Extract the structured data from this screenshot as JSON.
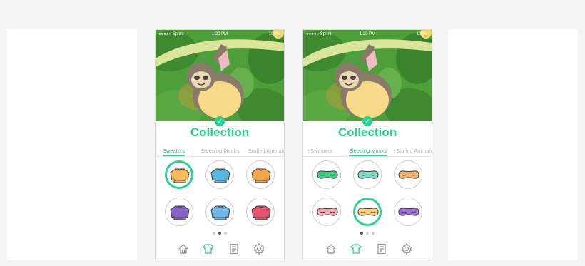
{
  "colors": {
    "accent": "#2fd18e",
    "hero_bg": "#4f9e3c",
    "background": "#f3f3f3"
  },
  "phones": [
    {
      "status": {
        "carrier": "●●●●○ Sprint",
        "time": "1:20 PM",
        "battery": "100%"
      },
      "title": "Collection",
      "tabs": [
        {
          "label": "Sweaters",
          "active": true
        },
        {
          "label": "Sleeping Masks",
          "active": false
        },
        {
          "label": "Stuffed Animals",
          "active": false
        }
      ],
      "items": [
        {
          "icon": "sweater-icon",
          "color": "#f4bd5a",
          "selected": true
        },
        {
          "icon": "sweater-icon",
          "color": "#5ab6e3",
          "selected": false
        },
        {
          "icon": "sweater-icon",
          "color": "#f2a64a",
          "selected": false
        },
        {
          "icon": "sweater-icon",
          "color": "#8a63c6",
          "selected": false
        },
        {
          "icon": "sweater-icon",
          "color": "#6fb7e6",
          "selected": false
        },
        {
          "icon": "sweater-icon",
          "color": "#e5556f",
          "selected": false
        }
      ],
      "page_indicator": {
        "count": 3,
        "active": 1
      },
      "nav": [
        "home-icon",
        "shirt-icon",
        "document-icon",
        "settings-icon"
      ],
      "nav_active": 1
    },
    {
      "status": {
        "carrier": "●●●●○ Sprint",
        "time": "1:20 PM",
        "battery": "100%"
      },
      "title": "Collection",
      "tabs": [
        {
          "label": "Sweaters",
          "active": false
        },
        {
          "label": "Sleeping Masks",
          "active": true
        },
        {
          "label": "Stuffed Animals",
          "active": false
        }
      ],
      "items": [
        {
          "icon": "sleeping-mask-icon",
          "color": "#3fcf85",
          "selected": false
        },
        {
          "icon": "sleeping-mask-icon",
          "color": "#7fdcc6",
          "selected": false
        },
        {
          "icon": "sleeping-mask-icon",
          "color": "#f4b66a",
          "selected": false
        },
        {
          "icon": "sleeping-mask-icon",
          "color": "#f5aab3",
          "selected": false
        },
        {
          "icon": "sleeping-mask-icon",
          "color": "#f6d07a",
          "selected": true
        },
        {
          "icon": "sleeping-mask-icon",
          "color": "#9b72cf",
          "selected": false
        }
      ],
      "page_indicator": {
        "count": 3,
        "active": 0
      },
      "nav": [
        "home-icon",
        "shirt-icon",
        "document-icon",
        "settings-icon"
      ],
      "nav_active": 1
    }
  ]
}
